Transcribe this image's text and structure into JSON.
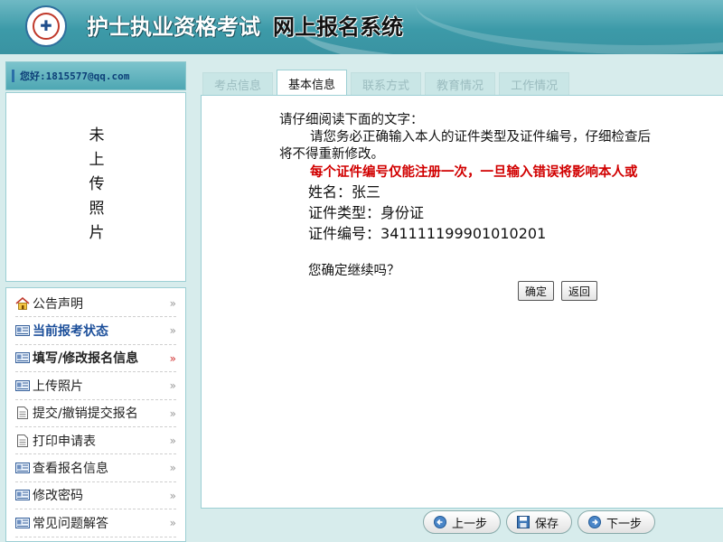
{
  "header": {
    "title_part1": "护士执业资格考试",
    "title_part2": "网上报名系统",
    "logo_icon": "emblem-logo"
  },
  "sidebar": {
    "greeting": "您好:1815577@qq.com",
    "photo_placeholder": [
      "未",
      "上",
      "传",
      "照",
      "片"
    ],
    "menu": [
      {
        "label": "公告声明",
        "icon": "house-icon"
      },
      {
        "label": "当前报考状态",
        "icon": "id-card-icon"
      },
      {
        "label": "填写/修改报名信息",
        "icon": "id-card-icon"
      },
      {
        "label": "上传照片",
        "icon": "id-card-icon"
      },
      {
        "label": "提交/撤销提交报名",
        "icon": "document-icon"
      },
      {
        "label": "打印申请表",
        "icon": "document-icon"
      },
      {
        "label": "查看报名信息",
        "icon": "id-card-icon"
      },
      {
        "label": "修改密码",
        "icon": "id-card-icon"
      },
      {
        "label": "常见问题解答",
        "icon": "id-card-icon"
      }
    ]
  },
  "tabs": [
    "考点信息",
    "基本信息",
    "联系方式",
    "教育情况",
    "工作情况"
  ],
  "active_tab": "基本信息",
  "notice": {
    "line1": "请仔细阅读下面的文字：",
    "line2": "请您务必正确输入本人的证件类型及证件编号，仔细检查后",
    "line3": "将不得重新修改。",
    "warning": "每个证件编号仅能注册一次，一旦输入错误将影响本人或"
  },
  "person": {
    "name": "姓名：张三",
    "id_type": "证件类型：身份证",
    "id_number_label": "证件编号：",
    "id_number": "341111199901010201"
  },
  "confirm_text": "您确定继续吗？",
  "buttons": {
    "ok": "确定",
    "back": "返回"
  },
  "footer": {
    "prev": "上一步",
    "save": "保存",
    "next": "下一步"
  },
  "colors": {
    "header_teal": "#3c9aa8",
    "background": "#d7ecec",
    "warning_red": "#d10000",
    "menu_blue": "#1c4f9a"
  }
}
